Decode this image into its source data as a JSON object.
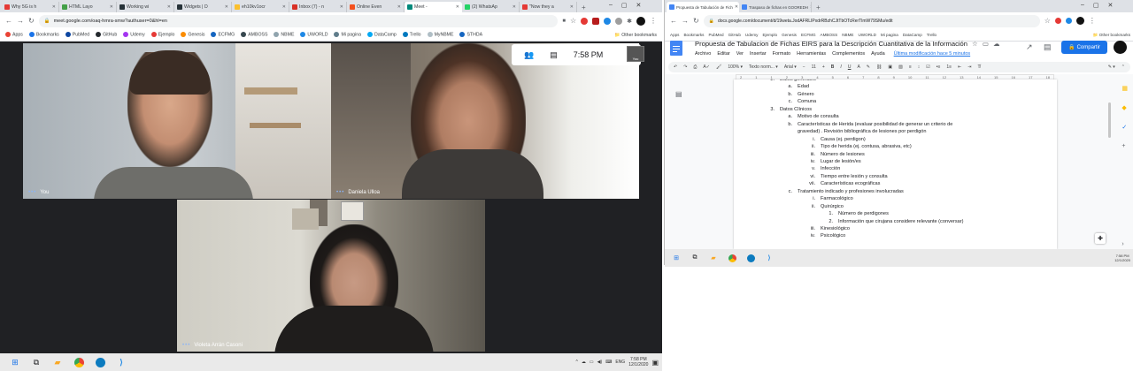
{
  "left_browser": {
    "tabs": [
      {
        "label": "Why 5G is h",
        "color": "#e53935"
      },
      {
        "label": "HTML Layo",
        "color": "#43a047"
      },
      {
        "label": "Working wi",
        "color": "#263238"
      },
      {
        "label": "Widgets | D",
        "color": "#263238"
      },
      {
        "label": "eh10kv1ocr",
        "color": "#fbc02d"
      },
      {
        "label": "Inbox (7) - n",
        "color": "#d93025"
      },
      {
        "label": "Online Even",
        "color": "#f4511e"
      },
      {
        "label": "Meet -",
        "color": "#00897b",
        "active": true
      },
      {
        "label": "(2) WhatsAp",
        "color": "#25d366"
      },
      {
        "label": "\"Now they a",
        "color": "#e53935"
      }
    ],
    "new_tab": "+",
    "window_controls": [
      "–",
      "▢",
      "✕"
    ],
    "url": "meet.google.com/oaq-hmra-smw?authuser=0&hl=en",
    "bookmarks": [
      {
        "label": "Apps",
        "color": "#ea4335"
      },
      {
        "label": "Bookmarks",
        "color": "#1a73e8"
      },
      {
        "label": "PubMed",
        "color": "#0d47a1"
      },
      {
        "label": "GitHub",
        "color": "#24292e"
      },
      {
        "label": "Udemy",
        "color": "#a435f0"
      },
      {
        "label": "Ejemplo",
        "color": "#e53935"
      },
      {
        "label": "Genesis",
        "color": "#fb8c00"
      },
      {
        "label": "ECFMG",
        "color": "#1565c0"
      },
      {
        "label": "AMBOSS",
        "color": "#37474f"
      },
      {
        "label": "NBME",
        "color": "#90a4ae"
      },
      {
        "label": "UWORLD",
        "color": "#1e88e5"
      },
      {
        "label": "Mi pagina",
        "color": "#607d8b"
      },
      {
        "label": "DataCamp",
        "color": "#03a9f4"
      },
      {
        "label": "Trello",
        "color": "#0079bf"
      },
      {
        "label": "MyNBME",
        "color": "#b0bec5"
      },
      {
        "label": "STHDA",
        "color": "#1565c0"
      }
    ],
    "other_bookmarks": "Other bookmarks"
  },
  "meet": {
    "time": "7:58 PM",
    "self_view_label": "You",
    "participants": [
      {
        "name": "You"
      },
      {
        "name": "Daniela Ulloa"
      },
      {
        "name": "Violeta Arrán Casoni"
      }
    ]
  },
  "left_taskbar": {
    "lang": "ENG",
    "time": "7:58 PM",
    "date": "12/1/2020"
  },
  "right_browser": {
    "tabs": [
      {
        "label": "Propuesta de Tabulación de Fich",
        "color": "#4285f4",
        "active": true
      },
      {
        "label": "Traspaso de fichas en GOOREDH",
        "color": "#4285f4"
      }
    ],
    "url": "docs.google.com/document/d/19weta.JodAFRLIPxdrRBzhCJtTbOTcRerTlmW79SMu/edit",
    "bookmarks": [
      "Apps",
      "Bookmarks",
      "PubMed",
      "GitHub",
      "Udemy",
      "Ejemplo",
      "Genesis",
      "ECFMG",
      "AMBOSS",
      "NBME",
      "UWORLD",
      "Mi pagina",
      "DataCamp",
      "Trello"
    ],
    "other_bookmarks": "Other bookmarks"
  },
  "docs": {
    "title": "Propuesta de Tabulacion de Fichas EIRS para la Descripción Cuantitativa de la Información",
    "menus": [
      "Archivo",
      "Editar",
      "Ver",
      "Insertar",
      "Formato",
      "Herramientas",
      "Complementos",
      "Ayuda"
    ],
    "last_edit": "Última modificación hace 5 minutos",
    "share": "Compartir",
    "zoom": "100%",
    "style": "Texto norm...",
    "font": "Arial",
    "font_size": "11",
    "ruler": [
      "2",
      "1",
      "1",
      "2",
      "3",
      "4",
      "5",
      "6",
      "7",
      "8",
      "9",
      "10",
      "11",
      "12",
      "13",
      "14",
      "15",
      "16",
      "17",
      "18"
    ],
    "lines": [
      {
        "n": "2.",
        "t": "Datos generales",
        "lvl": 0
      },
      {
        "n": "a.",
        "t": "Edad",
        "lvl": 1
      },
      {
        "n": "b.",
        "t": "Género",
        "lvl": 1
      },
      {
        "n": "c.",
        "t": "Comuna",
        "lvl": 1
      },
      {
        "n": "3.",
        "t": "Datos Clínicos",
        "lvl": 0
      },
      {
        "n": "a.",
        "t": "Motivo de consulta",
        "lvl": 1
      },
      {
        "n": "b.",
        "t": "Características de Herida (evaluar posibilidad de generar un criterio de",
        "lvl": 1
      },
      {
        "n": "",
        "t": "gravedad) . Revisión bibliográfica de lesiones por perdigón",
        "lvl": 1
      },
      {
        "n": "i.",
        "t": "Causa (ej. perdigon)",
        "lvl": 2
      },
      {
        "n": "ii.",
        "t": "Tipo de herida (ej. contusa, abrasiva, etc)",
        "lvl": 2
      },
      {
        "n": "iii.",
        "t": "Número de lesiones",
        "lvl": 2
      },
      {
        "n": "iv.",
        "t": "Lugar de lesión/es",
        "lvl": 2
      },
      {
        "n": "v.",
        "t": "Infección",
        "lvl": 2
      },
      {
        "n": "vi.",
        "t": "Tiempo entre lesión y consulta",
        "lvl": 2
      },
      {
        "n": "vii.",
        "t": "Características ecográficas",
        "lvl": 2
      },
      {
        "n": "c.",
        "t": "Tratamiento indicado y profesiones involucradas",
        "lvl": 1
      },
      {
        "n": "i.",
        "t": "Farmacológico",
        "lvl": 2
      },
      {
        "n": "ii.",
        "t": "Quirúrgico",
        "lvl": 2
      },
      {
        "n": "1.",
        "t": "Número de perdigones",
        "lvl": 3
      },
      {
        "n": "2.",
        "t": "Información que cirujana considere relevante (conversar)",
        "lvl": 3
      },
      {
        "n": "iii.",
        "t": "Kinesiológico",
        "lvl": 2
      },
      {
        "n": "iv.",
        "t": "Psicológico",
        "lvl": 2
      }
    ]
  },
  "right_taskbar": {
    "time": "7:58 PM",
    "date": "12/1/2020"
  }
}
